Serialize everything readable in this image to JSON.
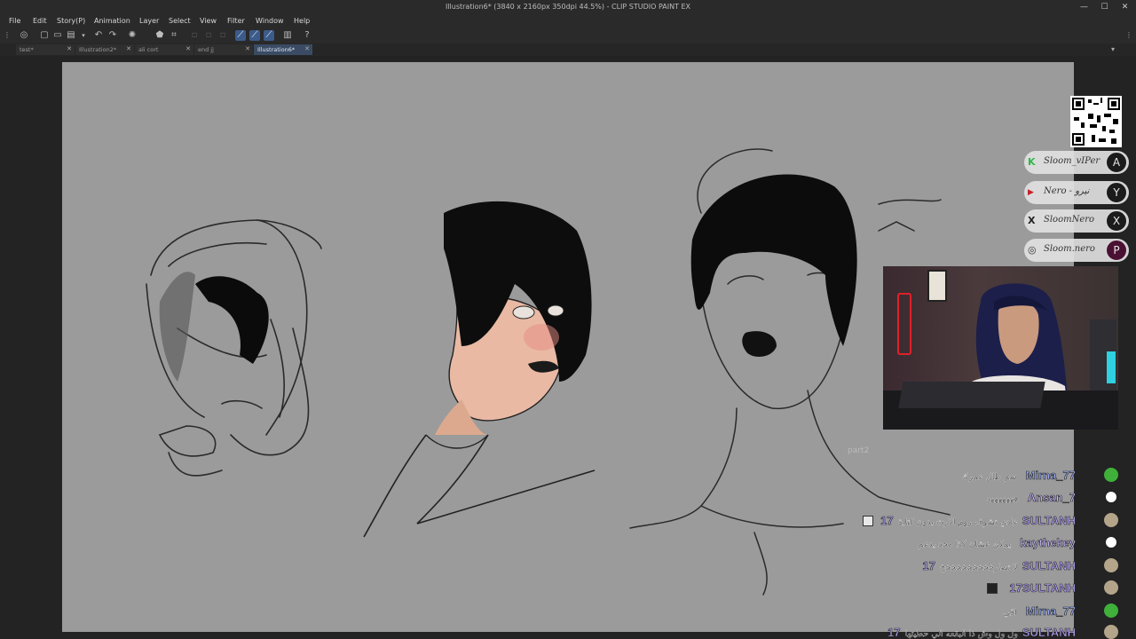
{
  "window": {
    "title": "Illustration6* (3840 x 2160px 350dpi 44.5%)  - CLIP STUDIO PAINT EX",
    "minimize_glyph": "—",
    "maximize_glyph": "☐",
    "close_glyph": "✕"
  },
  "menu": [
    "File",
    "Edit",
    "Story(P)",
    "Animation",
    "Layer",
    "Select",
    "View",
    "Filter",
    "Window",
    "Help"
  ],
  "tabs": [
    {
      "label": "test*",
      "active": false
    },
    {
      "label": "Illustration2*",
      "active": false
    },
    {
      "label": "ali cort",
      "active": false
    },
    {
      "label": "end jj",
      "active": false
    },
    {
      "label": "Illustration6*",
      "active": true
    }
  ],
  "tab_close_glyph": "✕",
  "toolbar_icons": [
    "clip-icon",
    "new-icon",
    "open-icon",
    "save-icon",
    "dropdown-icon",
    "undo-icon",
    "redo-icon",
    "spinner-icon",
    "transform-icon",
    "crop-icon",
    "clear-icon",
    "fill-icon",
    "stroke-icon",
    "ruler-snap-icon",
    "special-ruler-snap-icon",
    "grid-snap-icon",
    "material-icon",
    "help-icon"
  ],
  "overlay": {
    "socials": [
      {
        "icon": "k-logo-icon",
        "lead": "K",
        "lead_color": "#2fb84a",
        "handle": "Sloom_vIPer",
        "badge": "A"
      },
      {
        "icon": "youtube-icon",
        "lead": "▶",
        "lead_color": "#c4202a",
        "handle": "Nero - نيرو",
        "badge": "Y"
      },
      {
        "icon": "x-logo-icon",
        "lead": "X",
        "lead_color": "#222222",
        "handle": "SloomNero",
        "badge": "X"
      },
      {
        "icon": "instagram-icon",
        "lead": "◎",
        "lead_color": "#333333",
        "handle": "Sloom.nero",
        "badge": "P"
      }
    ],
    "webcam_label": "streamer webcam"
  },
  "chat": {
    "part_label": "part2",
    "messages": [
      {
        "user": "Mirna_77",
        "user_color": "#9fb3ff",
        "text": "سم طال عمرك",
        "avatar": "green-avatar-icon",
        "avatar_color": "#3fb03a",
        "emote": false
      },
      {
        "user": "Ansan_7",
        "user_color": "#c9b7ff",
        "text": "هههههههه",
        "avatar": "default-avatar-icon",
        "avatar_color": "#ffffff",
        "emote": false
      },
      {
        "user": "17SULTANH",
        "user_color": "#b9a6ff",
        "text": "عادي تشوف روم الارت بدون كتابة",
        "avatar": "cat-avatar-icon",
        "avatar_color": "#b4a58a",
        "emote": true
      },
      {
        "user": "kaythekey",
        "user_color": "#c8b8ff",
        "text": "يمكن عشان كذا محد يدعم",
        "avatar": "default-avatar-icon",
        "avatar_color": "#ffffff",
        "emote": false
      },
      {
        "user": "17SULTANH",
        "user_color": "#b9a6ff",
        "text": "لا تصارخخخخخخخخخخ",
        "avatar": "cat-avatar-icon",
        "avatar_color": "#b4a58a",
        "emote": false
      },
      {
        "user": "17SULTANH",
        "user_color": "#b9a6ff",
        "text": "",
        "avatar": "cat-avatar-icon",
        "avatar_color": "#b4a58a",
        "emote": true
      },
      {
        "user": "Mirna_77",
        "user_color": "#9fb3ff",
        "text": "اقي",
        "avatar": "green-avatar-icon",
        "avatar_color": "#3fb03a",
        "emote": false
      },
      {
        "user": "17SULTANH",
        "user_color": "#b9a6ff",
        "text": "ول ول وش ذا البقعه الي حطيتها",
        "avatar": "cat-avatar-icon",
        "avatar_color": "#b4a58a",
        "emote": false
      }
    ]
  },
  "colors": {
    "paper": "#9b9b9b",
    "app_bg": "#1f1f1f",
    "active_tab": "#3a4b63",
    "accent": "#3c5b8a"
  }
}
